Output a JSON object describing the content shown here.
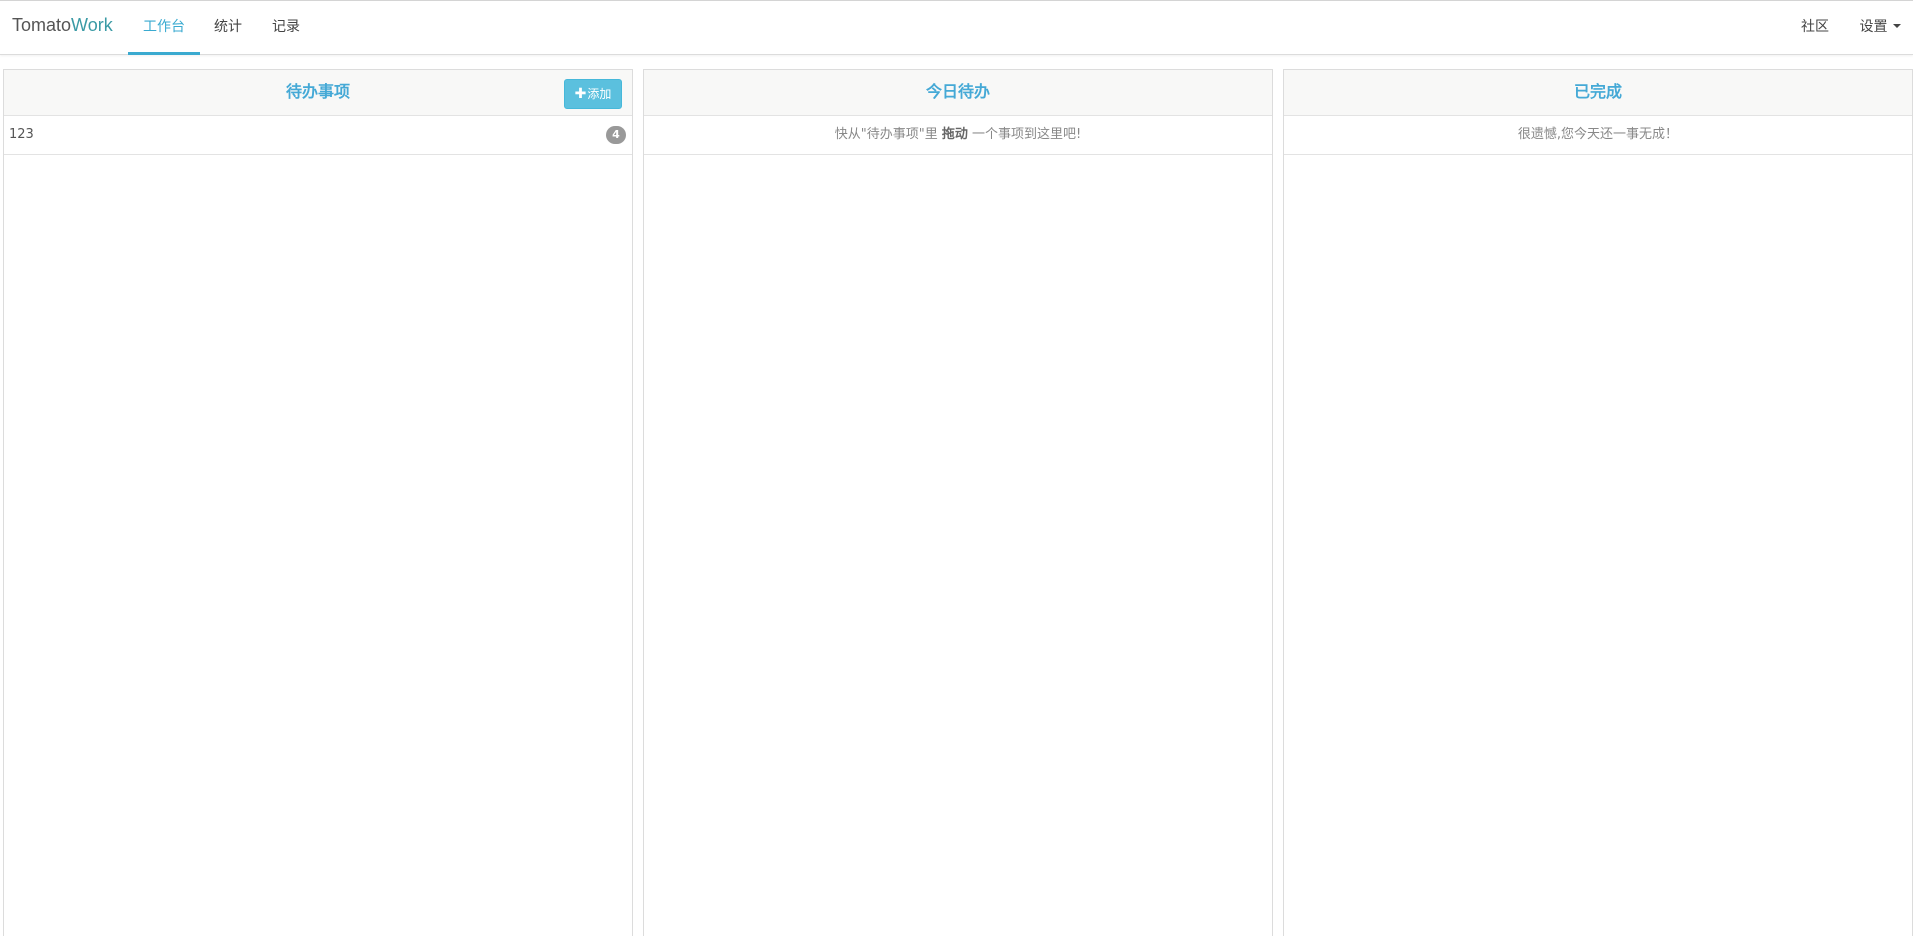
{
  "navbar": {
    "brand_prefix": "Tomato",
    "brand_accent": "Work",
    "items": [
      {
        "label": "工作台",
        "active": true
      },
      {
        "label": "统计"
      },
      {
        "label": "记录"
      }
    ],
    "right_items": [
      {
        "label": "社区"
      },
      {
        "label": "设置"
      }
    ]
  },
  "columns": [
    {
      "title": "待办事项",
      "add_button": {
        "icon": "plus-icon",
        "label": "添加"
      },
      "items": [
        {
          "text": "123",
          "count": "4"
        }
      ]
    },
    {
      "title": "今日待办",
      "hint_before": "快从\"待办事项\"里",
      "hint_strong": "拖动",
      "hint_after": "一个事项到这里吧!"
    },
    {
      "title": "已完成",
      "hint": "很遗憾,您今天还一事无成！"
    }
  ],
  "colors": {
    "accent": "#45a9d6",
    "brand_accent": "#3a9aa5",
    "button": "#5bc0de",
    "badge": "#999999"
  }
}
